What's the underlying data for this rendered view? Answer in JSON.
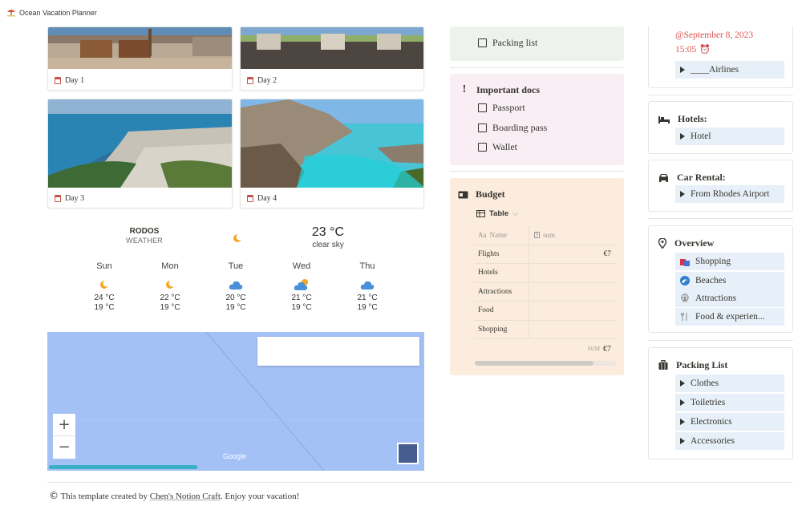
{
  "app": {
    "title": "Ocean Vacation Planner"
  },
  "gallery": [
    {
      "caption": "Day 1"
    },
    {
      "caption": "Day 2"
    },
    {
      "caption": "Day 3"
    },
    {
      "caption": "Day 4"
    }
  ],
  "weather": {
    "city": "RODOS",
    "subtitle": "WEATHER",
    "temp": "23 °C",
    "desc": "clear sky",
    "days": [
      {
        "name": "Sun",
        "hi": "24 °C",
        "lo": "19 °C",
        "icon": "partly-sunny-icon"
      },
      {
        "name": "Mon",
        "hi": "22 °C",
        "lo": "19 °C",
        "icon": "partly-sunny-icon"
      },
      {
        "name": "Tue",
        "hi": "20 °C",
        "lo": "19 °C",
        "icon": "cloud-icon"
      },
      {
        "name": "Wed",
        "hi": "21 °C",
        "lo": "19 °C",
        "icon": "sun-behind-cloud-icon"
      },
      {
        "name": "Thu",
        "hi": "21 °C",
        "lo": "19 °C",
        "icon": "cloud-icon"
      }
    ]
  },
  "map": {
    "zoom_in": "+",
    "zoom_out": "−",
    "attribution": "Google"
  },
  "checklist": {
    "packing_list": "Packing list"
  },
  "docs": {
    "title": "Important docs",
    "items": [
      "Passport",
      "Boarding pass",
      "Wallet"
    ]
  },
  "budget": {
    "title": "Budget",
    "view": "Table",
    "col_name": "Name",
    "col_sum": "sum",
    "rows": [
      {
        "name": "Flights",
        "sum": "€7"
      },
      {
        "name": "Hotels",
        "sum": ""
      },
      {
        "name": "Attractions",
        "sum": ""
      },
      {
        "name": "Food",
        "sum": ""
      },
      {
        "name": "Shopping",
        "sum": ""
      }
    ],
    "footer_label": "SUM",
    "footer_value": "€7"
  },
  "flight": {
    "date": "@September 8, 2023",
    "time": "15:05",
    "airline": "____Airlines"
  },
  "hotels": {
    "title": "Hotels:",
    "item": "Hotel"
  },
  "car": {
    "title": "Car Rental:",
    "item": "From Rhodes Airport"
  },
  "overview": {
    "title": "Overview",
    "items": [
      {
        "label": "Shopping",
        "icon": "shopping-bags-icon"
      },
      {
        "label": "Beaches",
        "icon": "wave-icon"
      },
      {
        "label": "Attractions",
        "icon": "ferris-wheel-icon"
      },
      {
        "label": "Food & experien...",
        "icon": "fork-knife-icon"
      }
    ]
  },
  "packing": {
    "title": "Packing List",
    "items": [
      "Clothes",
      "Toiletries",
      "Electronics",
      "Accessories"
    ]
  },
  "footer": {
    "copyright": "©",
    "prefix": "This template created by ",
    "link": "Chen's Notion Craft",
    "suffix": ". Enjoy your vacation!"
  },
  "colors": {
    "green_callout": "#edf3ec",
    "pink_callout": "#f9eef3",
    "orange_callout": "#fbecdd",
    "toggle_bg": "#e7f0f8",
    "date_red": "#df5452",
    "map_blue": "#a4c1f6"
  }
}
